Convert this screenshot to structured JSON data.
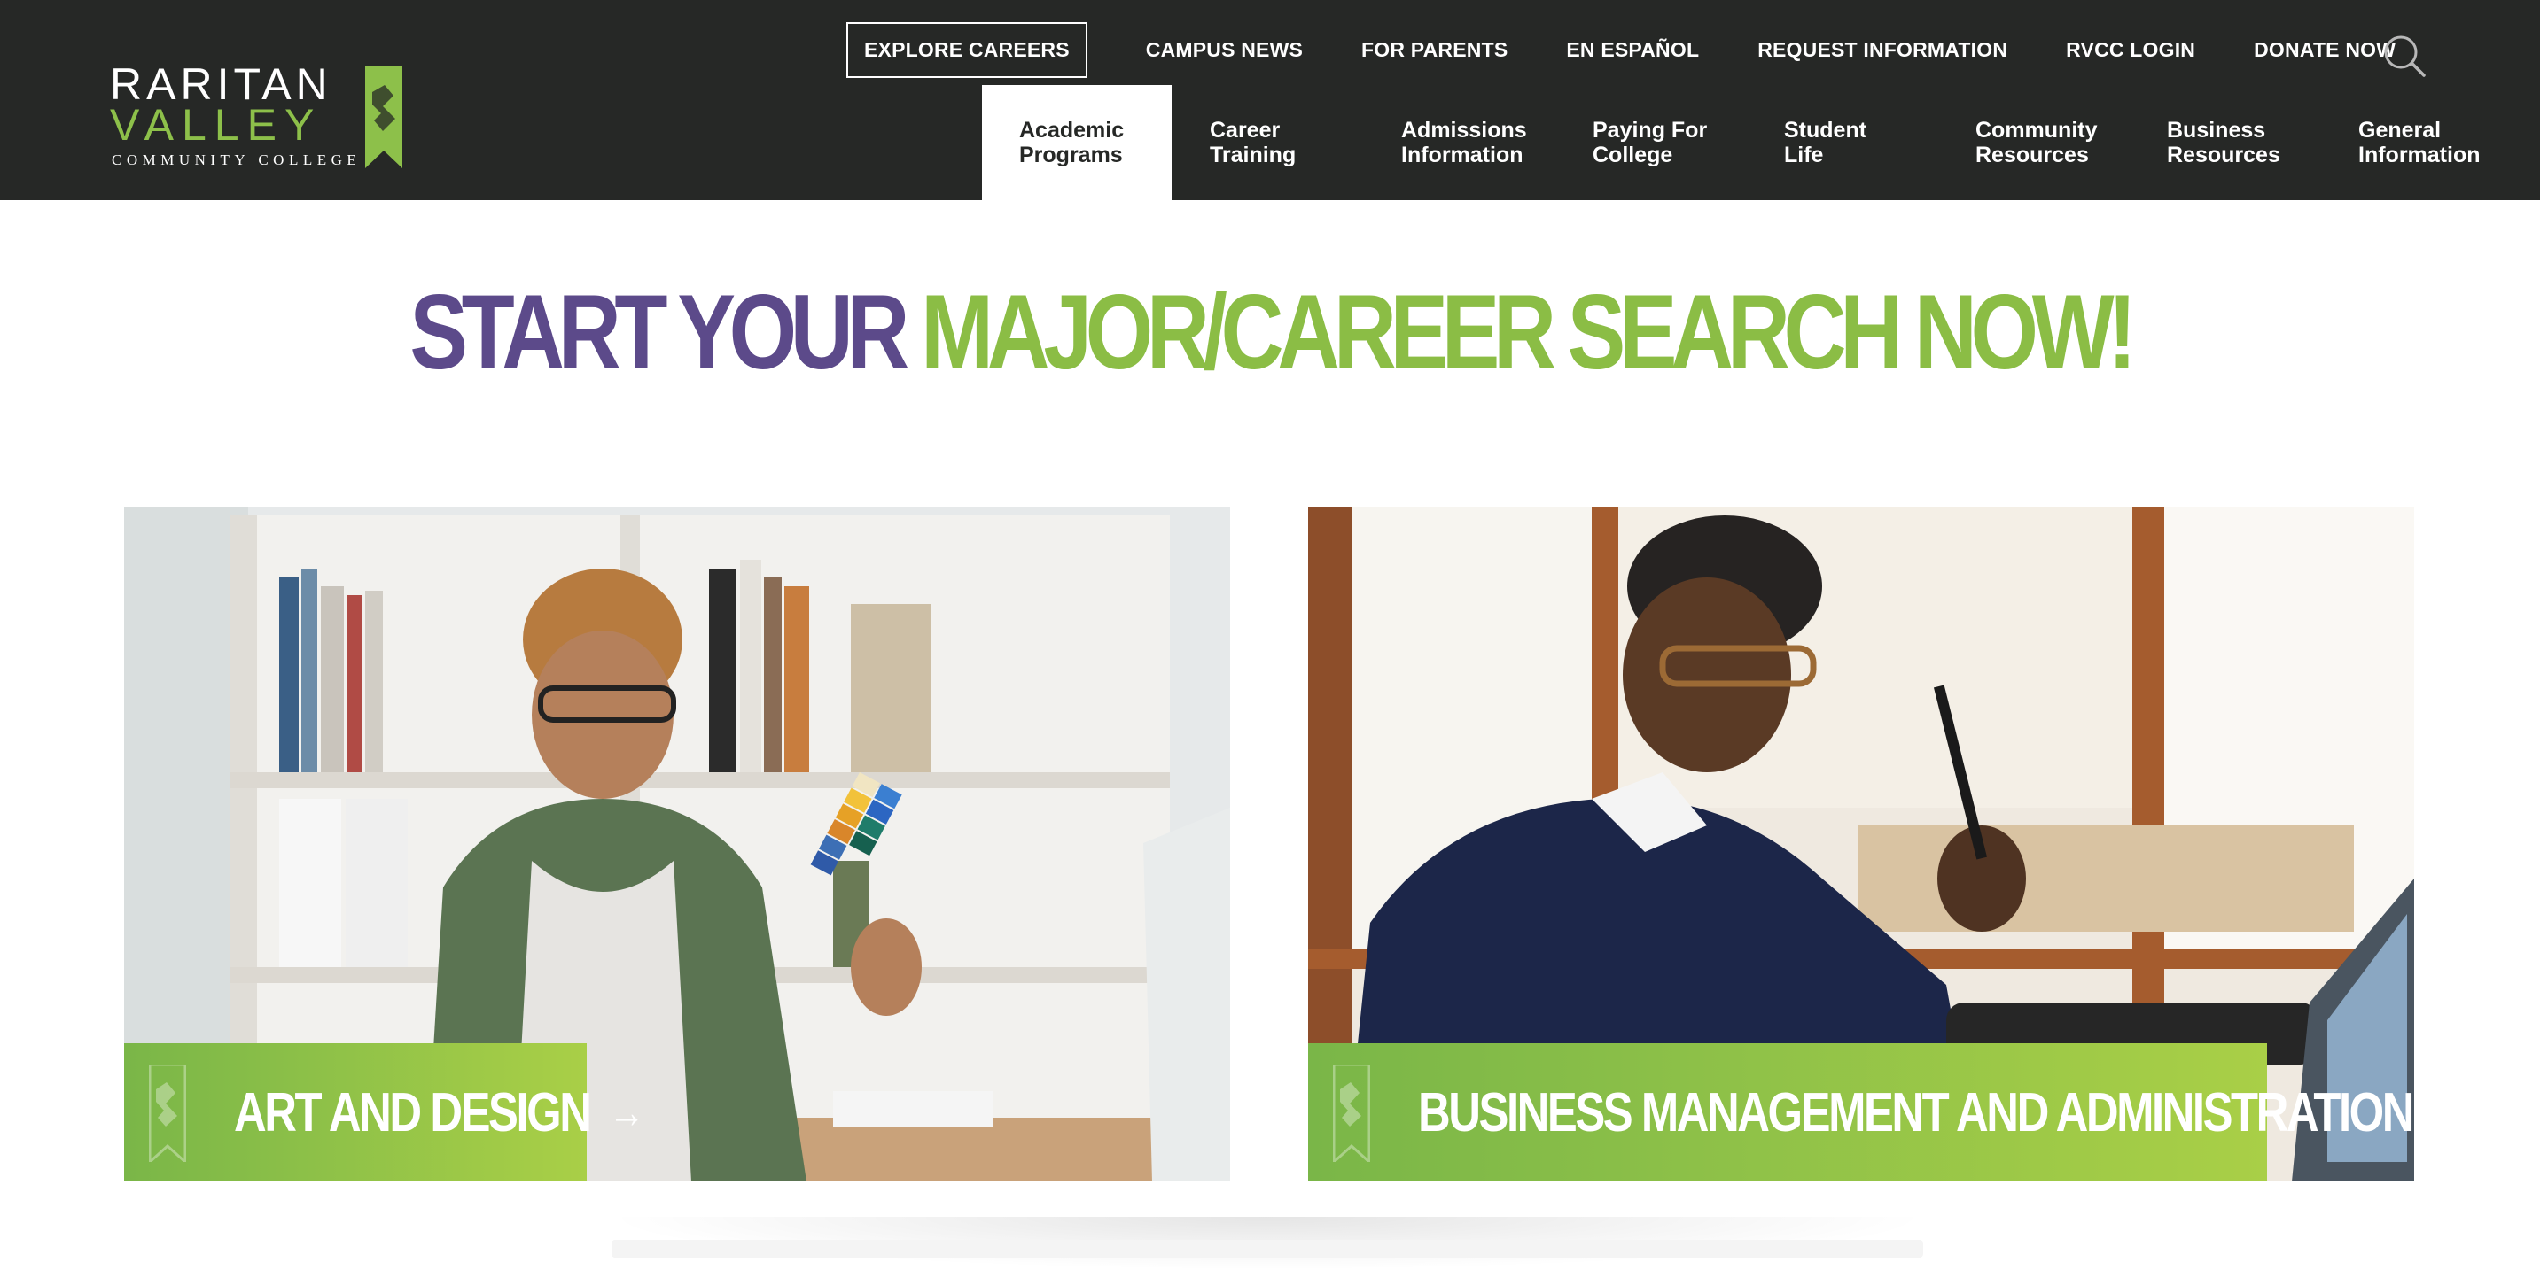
{
  "logo": {
    "line1": "RARITAN",
    "line2": "VALLEY",
    "line3": "COMMUNITY COLLEGE"
  },
  "utility_nav": [
    {
      "label": "EXPLORE CAREERS"
    },
    {
      "label": "CAMPUS NEWS"
    },
    {
      "label": "FOR PARENTS"
    },
    {
      "label": "EN ESPAÑOL"
    },
    {
      "label": "REQUEST INFORMATION"
    },
    {
      "label": "RVCC LOGIN"
    },
    {
      "label": "DONATE NOW"
    }
  ],
  "main_nav": [
    {
      "label": "Academic\nPrograms",
      "active": true
    },
    {
      "label": "Career\nTraining"
    },
    {
      "label": "Admissions\nInformation"
    },
    {
      "label": "Paying For\nCollege"
    },
    {
      "label": "Student\nLife"
    },
    {
      "label": "Community\nResources"
    },
    {
      "label": "Business\nResources"
    },
    {
      "label": "General\nInformation"
    }
  ],
  "headline": {
    "part1": "START YOUR",
    "part2": "MAJOR/CAREER SEARCH NOW!"
  },
  "cards": [
    {
      "label": "ART AND DESIGN",
      "arrow": "→"
    },
    {
      "label": "BUSINESS MANAGEMENT AND ADMINISTRATION",
      "arrow": "→"
    }
  ],
  "colors": {
    "header_bg": "#262826",
    "brand_green": "#8bbd45",
    "brand_purple": "#5c4a8a"
  },
  "icons": {
    "search": "search-icon",
    "logo_mark": "ribbon-logo-icon"
  }
}
